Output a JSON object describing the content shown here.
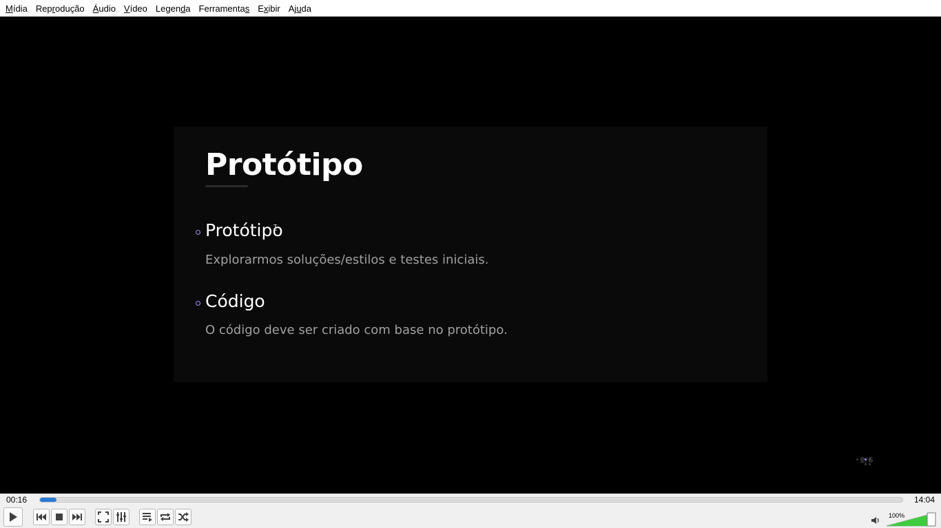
{
  "menu": {
    "items": [
      {
        "pre": "",
        "key": "M",
        "post": "ídia"
      },
      {
        "pre": "Rep",
        "key": "r",
        "post": "odução"
      },
      {
        "pre": "",
        "key": "Á",
        "post": "udio"
      },
      {
        "pre": "",
        "key": "V",
        "post": "ídeo"
      },
      {
        "pre": "Legen",
        "key": "d",
        "post": "a"
      },
      {
        "pre": "Ferramenta",
        "key": "s",
        "post": ""
      },
      {
        "pre": "E",
        "key": "x",
        "post": "ibir"
      },
      {
        "pre": "Aj",
        "key": "u",
        "post": "da"
      }
    ]
  },
  "slide": {
    "title": "Protótipo",
    "items": [
      {
        "heading": "Protótipo",
        "description": "Explorarmos soluções/estilos e testes iniciais."
      },
      {
        "heading": "Código",
        "description": "O código deve ser criado com base no protótipo."
      }
    ],
    "counter": "2/6",
    "accent_color": "#a78bfa"
  },
  "player": {
    "elapsed": "00:16",
    "total": "14:04",
    "progress": 0.019,
    "volume_label": "100%",
    "volume": 1.0,
    "icons": [
      "play-icon",
      "previous-icon",
      "stop-icon",
      "next-icon",
      "fullscreen-icon",
      "extended-settings-icon",
      "playlist-icon",
      "loop-icon",
      "shuffle-icon",
      "volume-icon"
    ]
  }
}
